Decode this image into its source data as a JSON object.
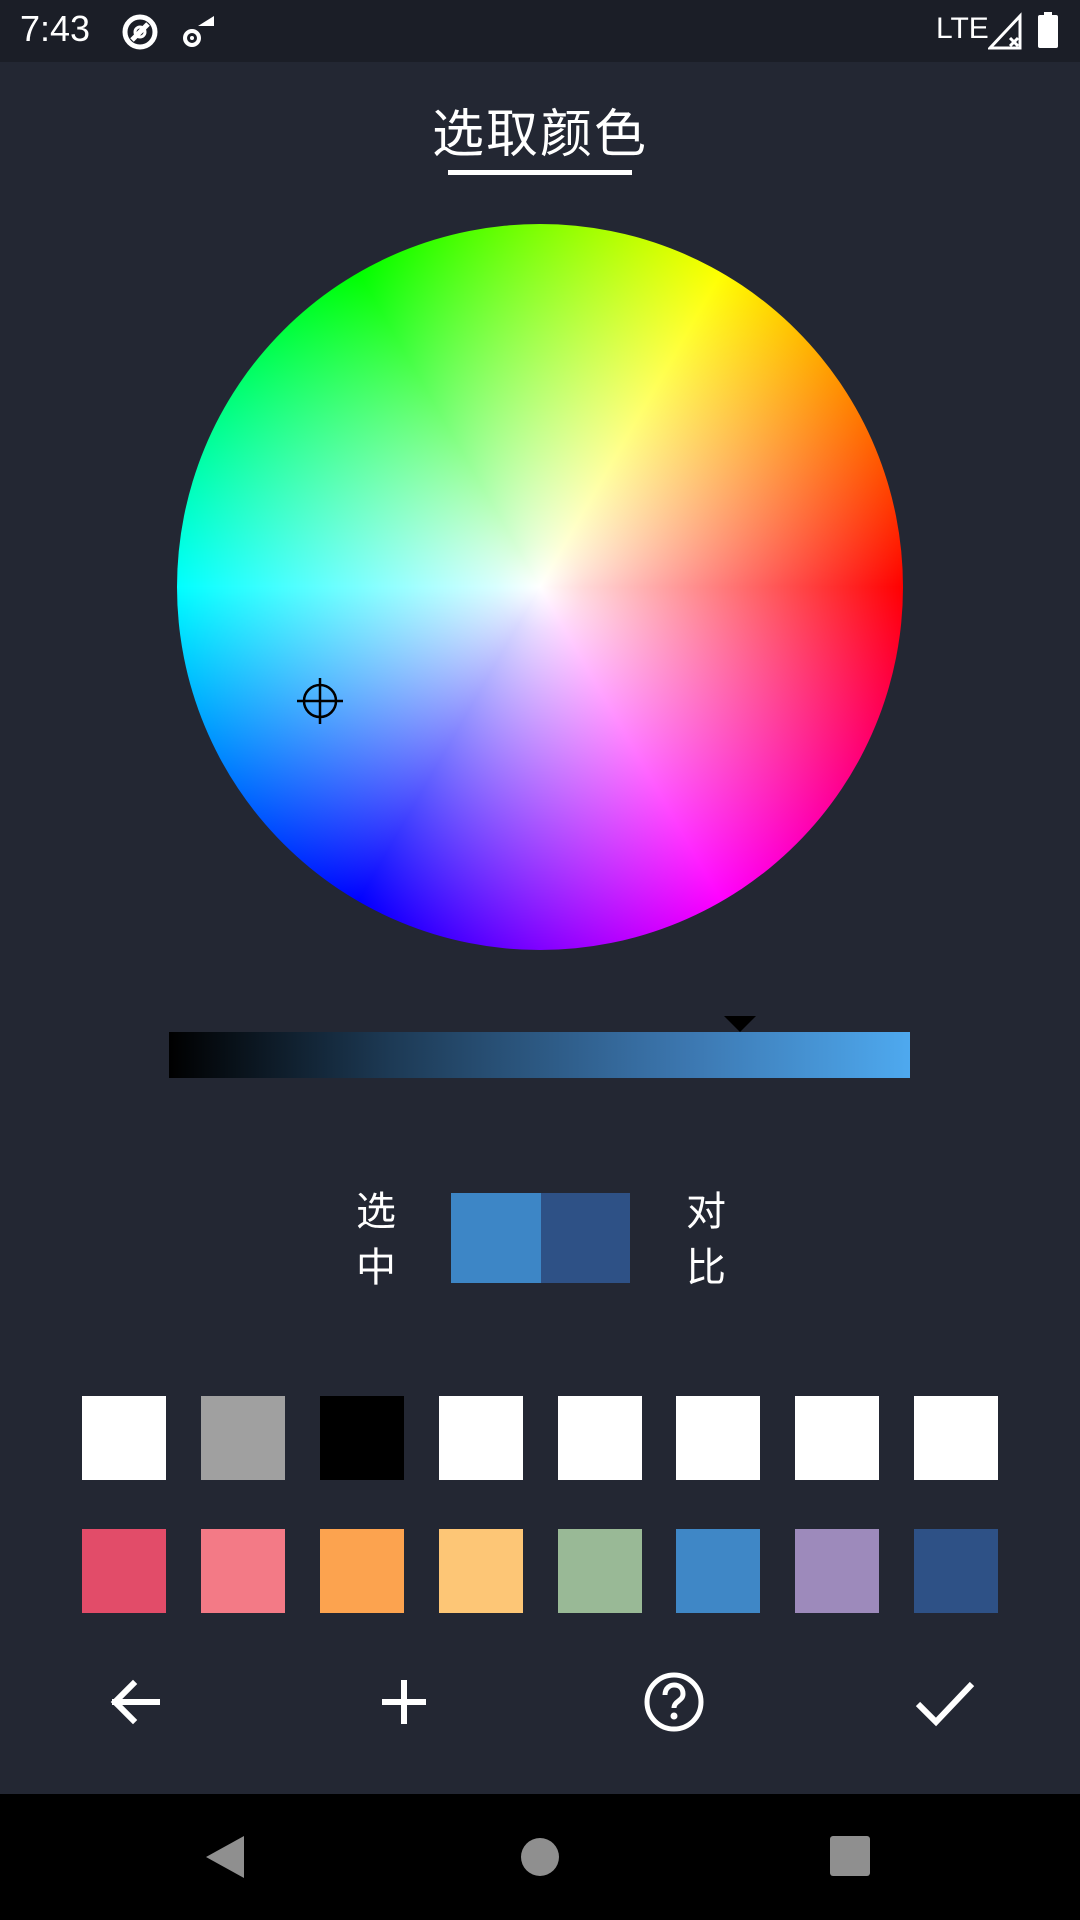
{
  "status_bar": {
    "time": "7:43",
    "network": "LTE"
  },
  "title": "选取颜色",
  "selected_label": [
    "选",
    "中"
  ],
  "compare_label": [
    "对",
    "比"
  ],
  "colors": {
    "selected": "#3d86c6",
    "compare": "#2e5186",
    "value_bar_end": "#4ea9ef"
  },
  "picker": {
    "brightness_level": 0.77
  },
  "palette_row1": [
    "#ffffff",
    "#a0a0a0",
    "#000000",
    "#ffffff",
    "#ffffff",
    "#ffffff",
    "#ffffff",
    "#ffffff"
  ],
  "palette_row2": [
    "#e24c69",
    "#f37a86",
    "#fca34f",
    "#fdc676",
    "#99b996",
    "#3f87c6",
    "#9d8abb",
    "#2e5186"
  ],
  "toolbar_icons": [
    "arrow-left-icon",
    "plus-icon",
    "help-icon",
    "check-icon"
  ],
  "nav_icons": [
    "back-triangle-icon",
    "home-circle-icon",
    "recents-square-icon"
  ]
}
